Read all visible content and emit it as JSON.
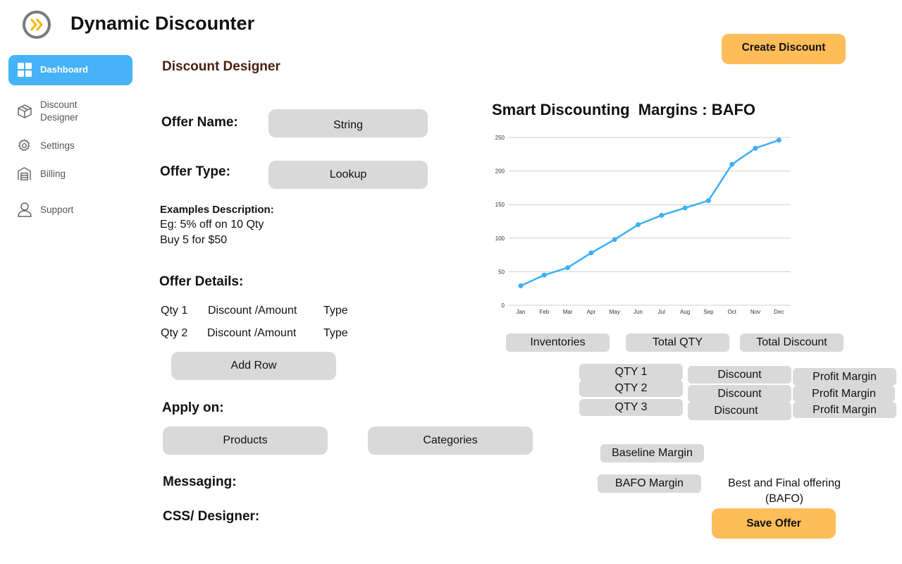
{
  "app": {
    "title": "Dynamic Discounter"
  },
  "sidebar": {
    "items": [
      {
        "label": "Dashboard",
        "icon": "grid-icon",
        "active": true
      },
      {
        "label": "Discount\nDesigner",
        "icon": "box-icon"
      },
      {
        "label": "Settings",
        "icon": "gear-icon"
      },
      {
        "label": "Billing",
        "icon": "warehouse-icon"
      },
      {
        "label": "Support",
        "icon": "user-icon"
      }
    ]
  },
  "header": {
    "create_label": "Create Discount"
  },
  "page": {
    "title": "Discount Designer"
  },
  "form": {
    "offer_name_label": "Offer Name:",
    "offer_name_value": "String",
    "offer_type_label": "Offer Type:",
    "offer_type_value": "Lookup",
    "examples_title": "Examples Description:",
    "examples_line1": "Eg: 5% off on 10 Qty",
    "examples_line2": "Buy 5 for $50",
    "offer_details_label": "Offer  Details:",
    "detail_rows": [
      {
        "qty": "Qty 1",
        "discount": "Discount /Amount",
        "type": "Type"
      },
      {
        "qty": "Qty 2",
        "discount": "Discount /Amount",
        "type": "Type"
      }
    ],
    "add_row_label": "Add Row",
    "apply_on_label": "Apply on:",
    "products_label": "Products",
    "categories_label": "Categories",
    "messaging_label": "Messaging:",
    "css_designer_label": "CSS/  Designer:"
  },
  "chart_data": {
    "type": "line",
    "title": "Smart Discounting  Margins : BAFO",
    "categories": [
      "Jan",
      "Feb",
      "Mar",
      "Apr",
      "May",
      "Jun",
      "Jul",
      "Aug",
      "Sep",
      "Oct",
      "Nov",
      "Dec"
    ],
    "values": [
      29,
      45,
      56,
      78,
      98,
      120,
      134,
      145,
      156,
      210,
      234,
      246
    ],
    "ylim": [
      0,
      250
    ],
    "yticks": [
      0,
      50,
      100,
      150,
      200,
      250
    ],
    "grid": true,
    "color": "#3cb0f4"
  },
  "metrics": {
    "headers": [
      "Inventories",
      "Total QTY",
      "Total Discount"
    ],
    "rows": [
      {
        "qty": "QTY 1",
        "discount": "Discount",
        "margin": "Profit Margin"
      },
      {
        "qty": "QTY 2",
        "discount": "Discount",
        "margin": "Profit Margin"
      },
      {
        "qty": "QTY 3",
        "discount": "Discount",
        "margin": "Profit Margin"
      }
    ],
    "baseline_label": "Baseline Margin",
    "bafo_label": "BAFO Margin",
    "bafo_desc": "Best and Final offering\n(BAFO)",
    "save_label": "Save Offer"
  },
  "colors": {
    "accent": "#ffbd59",
    "active_nav": "#46b2f7",
    "pill": "#d9d9d9",
    "section_title": "#4a1f12"
  }
}
